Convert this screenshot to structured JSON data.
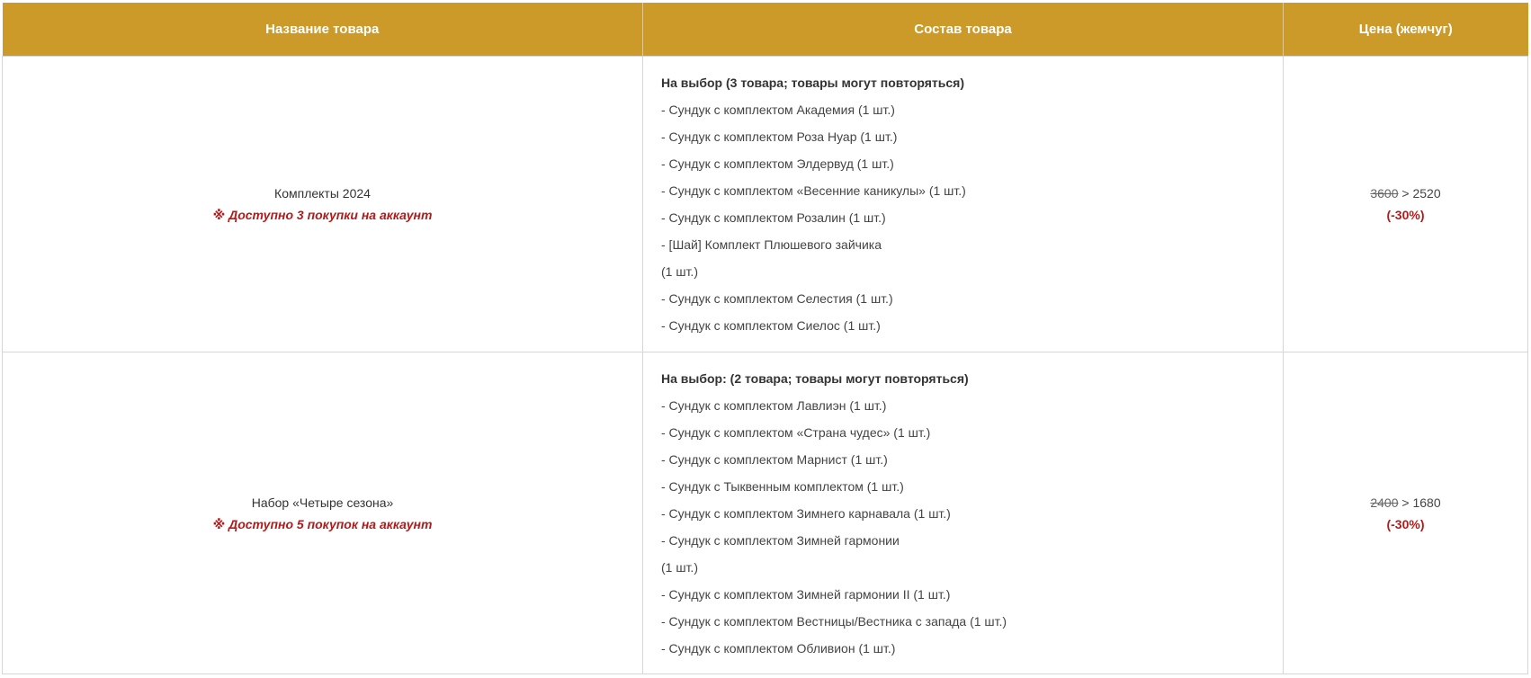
{
  "header": {
    "col_name": "Название товара",
    "col_contents": "Состав товара",
    "col_price": "Цена (жемчуг)"
  },
  "rows": [
    {
      "name": "Комплекты 2024",
      "limit": "※ Доступно 3 покупки на аккаунт",
      "contents_title": "На выбор (3 товара; товары могут повторяться)",
      "items": [
        "- Сундук с комплектом Академия (1 шт.)",
        "- Сундук с комплектом Роза Нуар (1 шт.)",
        "- Сундук с комплектом Элдервуд (1 шт.)",
        "- Сундук с комплектом «Весенние каникулы» (1 шт.)",
        "- Сундук с комплектом Розалин (1 шт.)",
        "- [Шай] Комплект Плюшевого зайчика",
        "(1 шт.)",
        "- Сундук с комплектом Селестия (1 шт.)",
        "- Сундук с комплектом Сиелос (1 шт.)"
      ],
      "price_old": "3600",
      "price_sep": " > ",
      "price_new": "2520",
      "discount": "(-30%)"
    },
    {
      "name": "Набор «Четыре сезона»",
      "limit": "※ Доступно 5 покупок на аккаунт",
      "contents_title": "На выбор: (2 товара; товары могут повторяться)",
      "items": [
        "- Сундук с комплектом Лавлиэн (1 шт.)",
        "- Сундук с комплектом «Страна чудес» (1 шт.)",
        "- Сундук с комплектом Марнист (1 шт.)",
        "- Сундук с Тыквенным комплектом (1 шт.)",
        "- Сундук с комплектом Зимнего карнавала (1 шт.)",
        "- Сундук с комплектом Зимней гармонии",
        "(1 шт.)",
        "- Сундук с комплектом Зимней гармонии II (1 шт.)",
        "- Сундук с комплектом Вестницы/Вестника с запада (1 шт.)",
        "- Сундук с комплектом Обливион (1 шт.)"
      ],
      "price_old": "2400",
      "price_sep": " > ",
      "price_new": "1680",
      "discount": "(-30%)"
    }
  ]
}
